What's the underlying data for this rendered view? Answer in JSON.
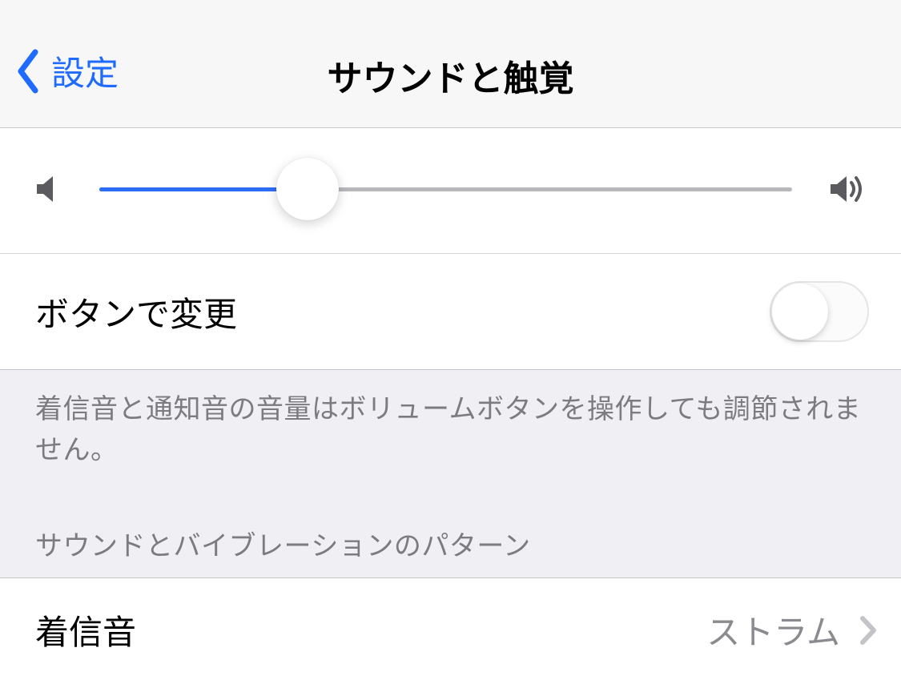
{
  "nav": {
    "back_label": "設定",
    "title": "サウンドと触覚"
  },
  "volume": {
    "percent": 30
  },
  "change_with_buttons": {
    "label": "ボタンで変更",
    "on": false,
    "footer": "着信音と通知音の音量はボリュームボタンを操作しても調節されません。"
  },
  "patterns_section": {
    "header": "サウンドとバイブレーションのパターン",
    "ringtone": {
      "label": "着信音",
      "value": "ストラム"
    }
  }
}
